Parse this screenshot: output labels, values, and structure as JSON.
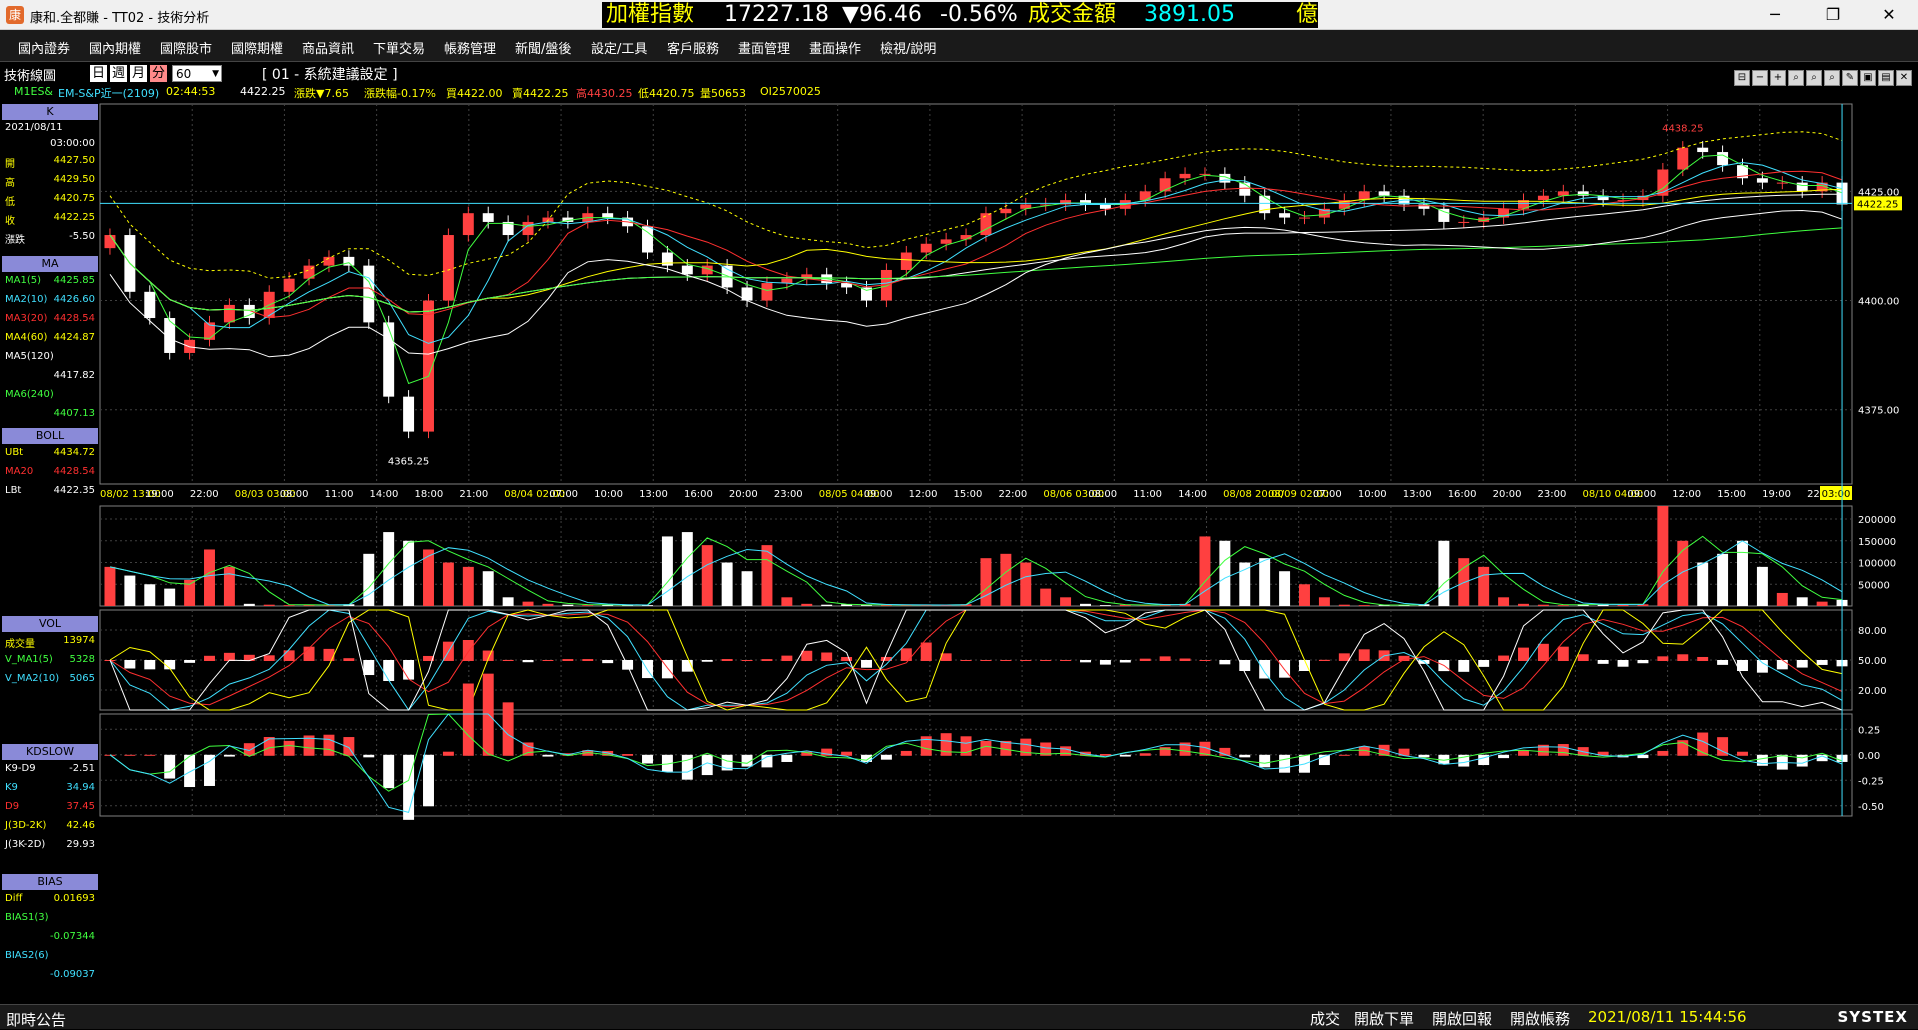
{
  "window": {
    "app_title": "康和.全都賺 - TT02 - 技術分析",
    "min": "─",
    "max": "❐",
    "close": "✕"
  },
  "ticker": {
    "index_label": "加權指數",
    "index_value": "17227.18",
    "change": "▼96.46",
    "change_pct": "-0.56%",
    "turnover_label": "成交金額",
    "turnover_value": "3891.05",
    "unit": "億"
  },
  "menu": [
    "國內證券",
    "國內期權",
    "國際股市",
    "國際期權",
    "商品資訊",
    "下單交易",
    "帳務管理",
    "新聞/盤後",
    "設定/工具",
    "客戶服務",
    "畫面管理",
    "畫面操作",
    "檢視/說明"
  ],
  "toolbar": {
    "label": "技術線圖",
    "periods": [
      "日",
      "週",
      "月",
      "分"
    ],
    "active_period": "分",
    "interval": "60",
    "setting": "[ 01 - 系統建議設定 ]"
  },
  "quote": {
    "symbol": "M1ES&",
    "name": "EM-S&P近一(2109)",
    "time": "02:44:53",
    "price": "4422.25",
    "change": "漲跌▼7.65",
    "change_pct": "漲跌幅-0.17%",
    "buy": "買4422.00",
    "sell": "賣4422.25",
    "high": "高4430.25",
    "low": "低4420.75",
    "volume": "量50653",
    "oi": "OI2570025"
  },
  "panels": {
    "k": {
      "header": "K",
      "date": "2021/08/11",
      "time": "03:00:00",
      "rows": [
        {
          "k": "開",
          "v": "4427.50"
        },
        {
          "k": "高",
          "v": "4429.50"
        },
        {
          "k": "低",
          "v": "4420.75"
        },
        {
          "k": "收",
          "v": "4422.25"
        },
        {
          "k": "漲跌",
          "v": "-5.50"
        }
      ]
    },
    "ma": {
      "header": "MA",
      "rows": [
        {
          "k": "MA1(5)",
          "v": "4425.85",
          "color": "#40ff40"
        },
        {
          "k": "MA2(10)",
          "v": "4426.60",
          "color": "#40e0ff"
        },
        {
          "k": "MA3(20)",
          "v": "4428.54",
          "color": "#ff3030"
        },
        {
          "k": "MA4(60)",
          "v": "4424.87",
          "color": "#ffff00"
        },
        {
          "k": "MA5(120)",
          "v": "4417.82",
          "color": "#ffffff"
        },
        {
          "k": "MA6(240)",
          "v": "4407.13",
          "color": "#40ff40"
        }
      ]
    },
    "boll": {
      "header": "BOLL",
      "rows": [
        {
          "k": "UBt",
          "v": "4434.72",
          "color": "#ffff00"
        },
        {
          "k": "MA20",
          "v": "4428.54",
          "color": "#ff3030"
        },
        {
          "k": "LBt",
          "v": "4422.35",
          "color": "#ffffff"
        }
      ]
    },
    "vol": {
      "header": "VOL",
      "rows": [
        {
          "k": "成交量",
          "v": "13974",
          "color": "#ffff00"
        },
        {
          "k": "V_MA1(5)",
          "v": "5328",
          "color": "#40ff40"
        },
        {
          "k": "V_MA2(10)",
          "v": "5065",
          "color": "#40e0ff"
        }
      ]
    },
    "kd": {
      "header": "KDSLOW",
      "rows": [
        {
          "k": "K9-D9",
          "v": "-2.51",
          "color": "#ffffff"
        },
        {
          "k": "K9",
          "v": "34.94",
          "color": "#40e0ff"
        },
        {
          "k": "D9",
          "v": "37.45",
          "color": "#ff3030"
        },
        {
          "k": "J(3D-2K)",
          "v": "42.46",
          "color": "#ffff00"
        },
        {
          "k": "J(3K-2D)",
          "v": "29.93",
          "color": "#ffffff"
        }
      ]
    },
    "bias": {
      "header": "BIAS",
      "rows": [
        {
          "k": "Diff",
          "v": "0.01693",
          "color": "#ffff00"
        },
        {
          "k": "BIAS1(3)",
          "v": "-0.07344",
          "color": "#40ff40"
        },
        {
          "k": "BIAS2(6)",
          "v": "-0.09037",
          "color": "#40e0ff"
        }
      ]
    }
  },
  "chart_data": {
    "type": "candlestick",
    "price_axis": {
      "ticks": [
        "4425.00",
        "4400.00",
        "4375.00"
      ],
      "ylim": [
        4358,
        4445
      ]
    },
    "current_price_label": "4422.25",
    "annotations": {
      "high": "4438.25",
      "low": "4365.25"
    },
    "time_labels": [
      "08/02 13:00",
      "19:00",
      "22:00",
      "08/03 03:00",
      "08:00",
      "11:00",
      "14:00",
      "18:00",
      "21:00",
      "08/04 02:00",
      "07:00",
      "10:00",
      "13:00",
      "16:00",
      "20:00",
      "23:00",
      "08/05 04:00",
      "09:00",
      "12:00",
      "15:00",
      "22:00",
      "08/06 03:00",
      "08:00",
      "11:00",
      "14:00",
      "08/08 20:00",
      "08/09 02:00",
      "07:00",
      "10:00",
      "13:00",
      "16:00",
      "20:00",
      "23:00",
      "08/10 04:00",
      "09:00",
      "12:00",
      "15:00",
      "19:00",
      "22:00",
      "03:00"
    ],
    "close": [
      4415,
      4402,
      4396,
      4388,
      4391,
      4395,
      4399,
      4396,
      4402,
      4405,
      4408,
      4410,
      4408,
      4395,
      4378,
      4370,
      4400,
      4415,
      4420,
      4418,
      4415,
      4418,
      4419,
      4418,
      4420,
      4419,
      4417,
      4411,
      4408,
      4406,
      4408,
      4403,
      4400,
      4404,
      4405,
      4406,
      4404,
      4403,
      4400,
      4407,
      4411,
      4413,
      4414,
      4415,
      4420,
      4421,
      4422,
      4422,
      4423,
      4422,
      4421,
      4423,
      4425,
      4428,
      4429,
      4429,
      4427,
      4424,
      4420,
      4419,
      4419,
      4421,
      4423,
      4425,
      4424,
      4422,
      4421,
      4418,
      4418,
      4419,
      4421,
      4423,
      4424,
      4425,
      4424,
      4423,
      4423,
      4424,
      4430,
      4435,
      4434,
      4431,
      4428,
      4427,
      4427,
      4425,
      4427,
      4422
    ],
    "volume_axis": {
      "ticks": [
        "200000",
        "150000",
        "100000",
        "50000"
      ],
      "ylim": [
        0,
        230000
      ]
    },
    "volume": [
      90000,
      70000,
      50000,
      40000,
      60000,
      130000,
      90000,
      5000,
      3000,
      2000,
      3000,
      2000,
      4000,
      120000,
      170000,
      150000,
      130000,
      100000,
      90000,
      80000,
      20000,
      10000,
      5000,
      3000,
      2000,
      3000,
      2000,
      2000,
      160000,
      170000,
      140000,
      100000,
      80000,
      140000,
      20000,
      5000,
      3000,
      4000,
      2000,
      3000,
      2000,
      2000,
      3000,
      4000,
      110000,
      120000,
      100000,
      40000,
      20000,
      5000,
      2000,
      3000,
      2000,
      4000,
      5000,
      160000,
      150000,
      100000,
      110000,
      80000,
      50000,
      20000,
      3000,
      2000,
      2000,
      3000,
      4000,
      150000,
      110000,
      90000,
      20000,
      5000,
      3000,
      2000,
      4000,
      5000,
      3000,
      4000,
      230000,
      150000,
      100000,
      120000,
      150000,
      90000,
      30000,
      20000,
      10000,
      14000
    ],
    "kd_axis": {
      "ticks": [
        "80.00",
        "50.00",
        "20.00"
      ],
      "ylim": [
        0,
        100
      ]
    },
    "bias_axis": {
      "ticks": [
        "0.25",
        "0.00",
        "-0.25",
        "-0.50"
      ],
      "ylim": [
        -0.6,
        0.4
      ]
    }
  }
}
